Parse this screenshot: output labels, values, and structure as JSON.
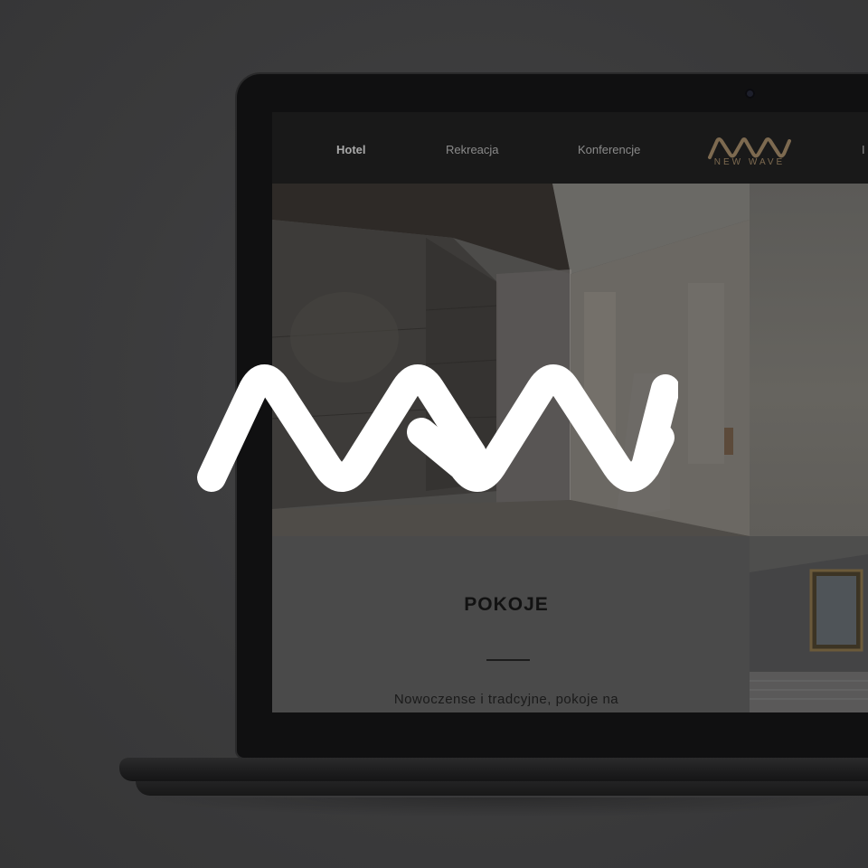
{
  "site": {
    "nav": [
      {
        "label": "Hotel",
        "active": true
      },
      {
        "label": "Rekreacja",
        "active": false
      },
      {
        "label": "Konferencje",
        "active": false
      },
      {
        "label": "I",
        "active": false
      }
    ],
    "brand_name": "NEW WAVE"
  },
  "section": {
    "title": "POKOJE",
    "text": "Nowoczense i tradcyjne, pokoje na"
  },
  "colors": {
    "brand_gold": "#7d6a50",
    "overlay_logo": "#ffffff"
  },
  "icons": {
    "brand_logo": "nw-wave-logo",
    "overlay_logo": "nw-wave-logo"
  }
}
